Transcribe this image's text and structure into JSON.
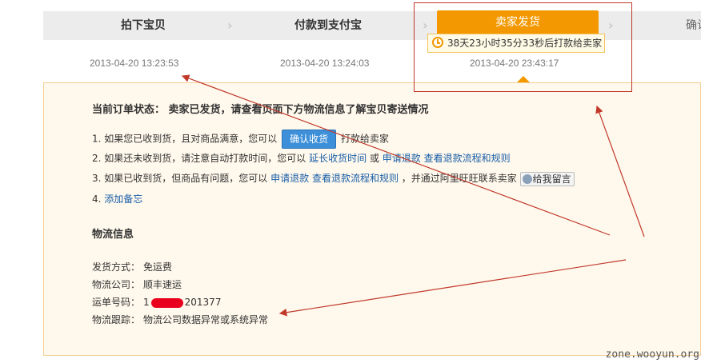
{
  "progress": {
    "steps": [
      "拍下宝贝",
      "付款到支付宝",
      "卖家发货",
      "确认"
    ],
    "active_index": 2,
    "times": [
      "2013-04-20 13:23:53",
      "2013-04-20 13:24:03",
      "2013-04-20 23:43:17"
    ],
    "countdown": "38天23小时35分33秒后打款给卖家"
  },
  "order": {
    "status_label": "当前订单状态：",
    "status_text": "卖家已发货，请查看页面下方物流信息了解宝贝寄送情况",
    "tips": {
      "tip1_pre": "1.  如果您已收到货，且对商品满意，您可以",
      "confirm_button": "确认收货",
      "tip1_post": "打款给卖家",
      "tip2_pre": "2.  如果还未收到货，请注意自动打款时间，您可以",
      "extend_link": "延长收货时间",
      "or": "或",
      "refund_link": "申请退款",
      "refund_flow_link": "查看退款流程和规则",
      "tip3_pre": "3.  如果已收到货，但商品有问题，您可以",
      "tip3_post": "，并通过阿里旺旺联系卖家",
      "leave_msg": "给我留言",
      "tip4_num": "4.",
      "add_note_link": "添加备忘"
    }
  },
  "logistics": {
    "title": "物流信息",
    "method_label": "发货方式：",
    "method": "免运费",
    "company_label": "物流公司：",
    "company": "顺丰速运",
    "tracking_label": "运单号码：",
    "tracking_prefix": "1",
    "tracking_suffix": "201377",
    "trace_label": "物流跟踪：",
    "trace": "物流公司数据异常或系统异常"
  },
  "watermark": "zone.wooyun.org",
  "colors": {
    "accent": "#f39800",
    "link": "#1a5fa8",
    "annotation": "#c0392b"
  }
}
